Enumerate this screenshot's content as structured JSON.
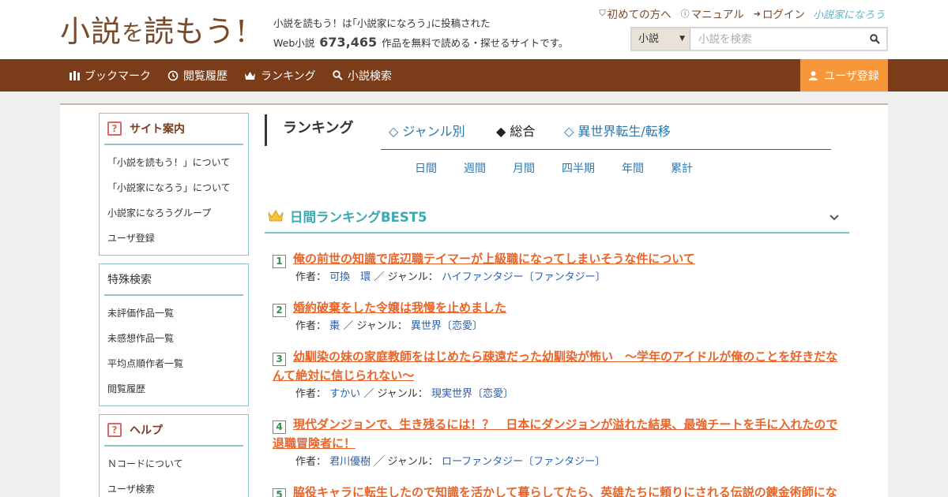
{
  "header": {
    "logo_main": "小説",
    "logo_small": "を",
    "logo_rest": "読もう!",
    "tagline_line1": "小説を読もう！は｢小説家になろう｣に投稿された",
    "tagline_prefix": "Web小説",
    "work_count": "673,465",
    "tagline_suffix": "作品を無料で読める・探せるサイトです。",
    "links": [
      "初めての方へ",
      "マニュアル",
      "ログイン"
    ],
    "brand": "小説家になろう",
    "search": {
      "type_value": "小説",
      "placeholder": "小説を検索"
    }
  },
  "nav": {
    "items": [
      "ブックマーク",
      "閲覧履歴",
      "ランキング",
      "小説検索"
    ],
    "register": "ユーザ登録"
  },
  "sidebar": {
    "site_guide": {
      "title": "サイト案内",
      "items": [
        "「小説を読もう！」について",
        "「小説家になろう」について",
        "小説家になろうグループ",
        "ユーザ登録"
      ]
    },
    "special_search": {
      "title": "特殊検索",
      "items": [
        "未評価作品一覧",
        "未感想作品一覧",
        "平均点順作者一覧",
        "閲覧履歴"
      ]
    },
    "help": {
      "title": "ヘルプ",
      "items": [
        "Ｎコードについて",
        "ユーザ検索"
      ]
    }
  },
  "content": {
    "title": "ランキング",
    "tabs": [
      {
        "label": "◇ ジャンル別"
      },
      {
        "label": "◆ 総合"
      },
      {
        "label": "◇ 異世界転生/転移"
      }
    ],
    "periods": [
      "日間",
      "週間",
      "月間",
      "四半期",
      "年間",
      "累計"
    ],
    "section_title": "日間ランキングBEST5",
    "labels": {
      "author": "作者：",
      "genre": "／ ジャンル："
    },
    "novels": [
      {
        "rank": "1",
        "title": "俺の前世の知識で底辺職テイマーが上級職になってしまいそうな件について",
        "author": "可換　環",
        "genre": "ハイファンタジー〔ファンタジー〕"
      },
      {
        "rank": "2",
        "title": "婚約破棄をした令嬢は我慢を止めました",
        "author": "棗",
        "genre": "異世界〔恋愛〕"
      },
      {
        "rank": "3",
        "title": "幼馴染の妹の家庭教師をはじめたら疎遠だった幼馴染が怖い　～学年のアイドルが俺のことを好きだなんて絶対に信じられない～",
        "author": "すかい",
        "genre": "現実世界〔恋愛〕"
      },
      {
        "rank": "4",
        "title": "現代ダンジョンで、生き残るには！？　日本にダンジョンが溢れた結果、最強チートを手に入れたので退職冒険者に！",
        "author": "君川優樹",
        "genre": "ローファンタジー〔ファンタジー〕"
      },
      {
        "rank": "5",
        "title": "脇役キャラに転生したので知識を活かして暮らしてたら、英雄たちに頼りにされる伝説の錬金術師にな",
        "author": "",
        "genre": ""
      }
    ]
  },
  "colors": {
    "brand_brown": "#7b3c1a",
    "accent_orange": "#f5973a",
    "link_blue": "#2a78b0",
    "title_orange": "#e8652a",
    "teal": "#3aa9b0"
  }
}
